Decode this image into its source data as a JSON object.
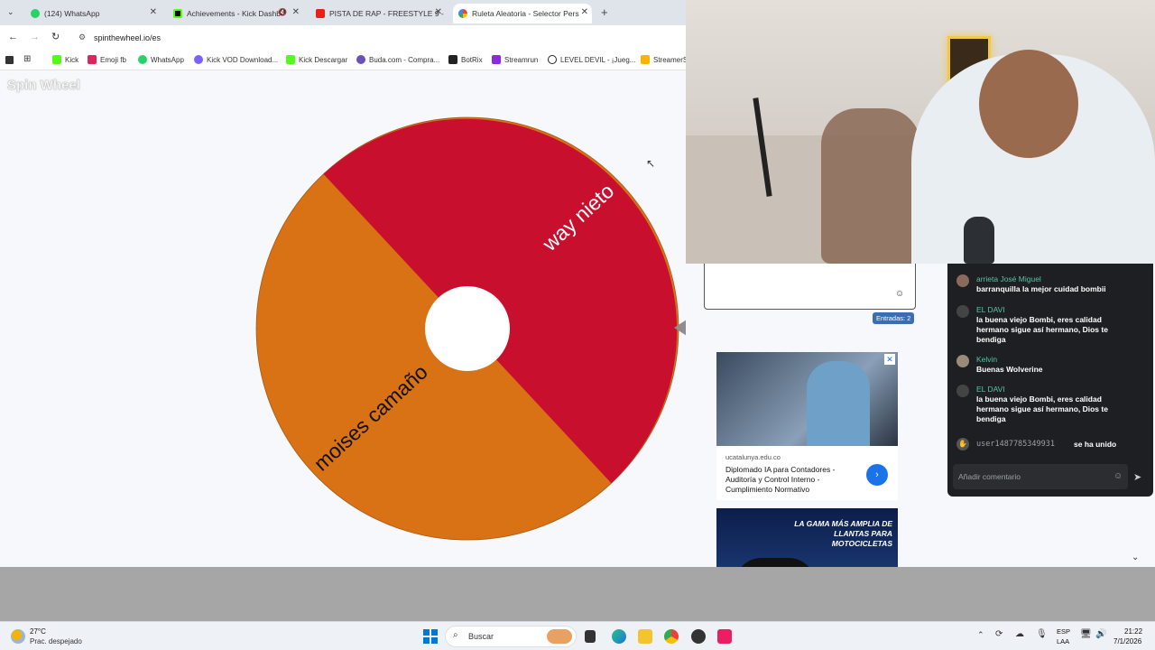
{
  "browser": {
    "tabs": [
      {
        "label": "(124) WhatsApp",
        "color": "#25d366"
      },
      {
        "label": "Achievements - Kick Dashb",
        "color": "#0c0c0c"
      },
      {
        "label": "PISTA DE RAP - FREESTYLE 9 -",
        "color": "#e62117"
      },
      {
        "label": "Ruleta Aleatoria - Selector Pers",
        "color": "#4285f4"
      }
    ],
    "new_tab": "+",
    "address": "spinthewheel.io/es",
    "bookmarks": [
      {
        "label": "Kick",
        "color": "#53fc18"
      },
      {
        "label": "Emoji fb",
        "color": "#e0245e"
      },
      {
        "label": "WhatsApp",
        "color": "#25d366"
      },
      {
        "label": "Kick VOD Download...",
        "color": "#7b61ff"
      },
      {
        "label": "Kick Descargar",
        "color": "#53fc18"
      },
      {
        "label": "Buda.com - Compra...",
        "color": "#6b4fbb"
      },
      {
        "label": "BotRix",
        "color": "#222222"
      },
      {
        "label": "Streamrun",
        "color": "#8a2be2"
      },
      {
        "label": "LEVEL DEVIL - ¡Jueg...",
        "color": "#222222"
      },
      {
        "label": "StreamerS",
        "color": "#f7b500"
      }
    ]
  },
  "page": {
    "logo": "Spin Wheel",
    "wheel": {
      "segments": [
        {
          "label": "way nieto",
          "color": "#c8102e"
        },
        {
          "label": "moises camaño",
          "color": "#d97115"
        }
      ]
    },
    "entries_badge": "Entradas: 2",
    "ad": {
      "domain": "ucatalunya.edu.co",
      "title": "Diplomado IA para Contadores - Auditoría y Control Interno - Cumplimiento Normativo",
      "banner_text": "LA GAMA MÁS AMPLIA DE LLANTAS PARA MOTOCICLETAS"
    }
  },
  "chat": {
    "messages": [
      {
        "user": "arrieta José Miguel",
        "text": "barranquilla la mejor cuidad bombii"
      },
      {
        "user": "EL DAVI",
        "text": "la buena viejo Bombi, eres calidad hermano sigue así hermano, Dios te bendiga"
      },
      {
        "user": "Kelvin",
        "text": "Buenas Wolverine"
      },
      {
        "user": "EL DAVI",
        "text": "la buena viejo Bombi, eres calidad hermano sigue así hermano, Dios te bendiga"
      }
    ],
    "join_user": "user1487785349931",
    "join_text": "se ha unido",
    "comment_placeholder": "Añadir comentario"
  },
  "taskbar": {
    "temp": "27°C",
    "weather": "Prac. despejado",
    "search": "Buscar",
    "lang1": "ESP",
    "lang2": "LAA",
    "time": "21:22",
    "date": "7/1/2026"
  }
}
